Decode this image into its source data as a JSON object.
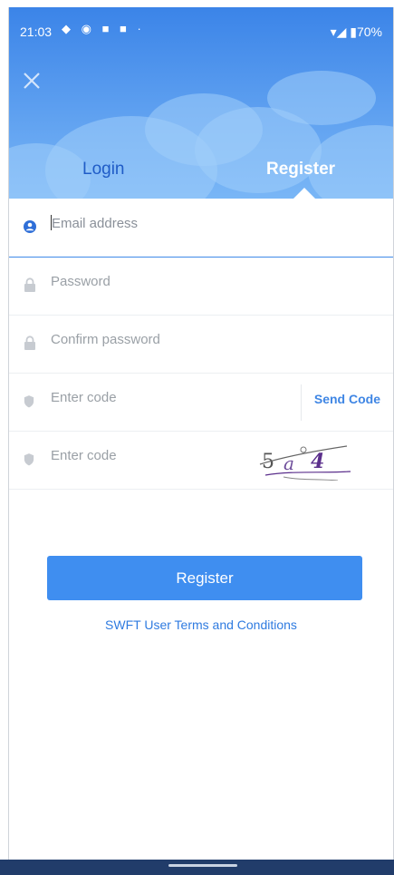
{
  "status_bar": {
    "time": "21:03",
    "notification_icons": "◆ ◉ ■ ■ ·",
    "right": "▾◢ ▮70%"
  },
  "tabs": [
    {
      "label": "Login",
      "active": false
    },
    {
      "label": "Register",
      "active": true
    }
  ],
  "form": {
    "email_placeholder": "Email address",
    "password_placeholder": "Password",
    "confirm_placeholder": "Confirm password",
    "code_placeholder": "Enter code",
    "send_code_label": "Send Code",
    "captcha_code_placeholder": "Enter code",
    "captcha_text": "5a4"
  },
  "actions": {
    "register_label": "Register",
    "terms_label": "SWFT User Terms and Conditions"
  },
  "colors": {
    "primary": "#3f8ef0",
    "header_top": "#3b84e8",
    "active_field_icon": "#2f6fd8",
    "inactive_icon": "#c7cbd1"
  }
}
